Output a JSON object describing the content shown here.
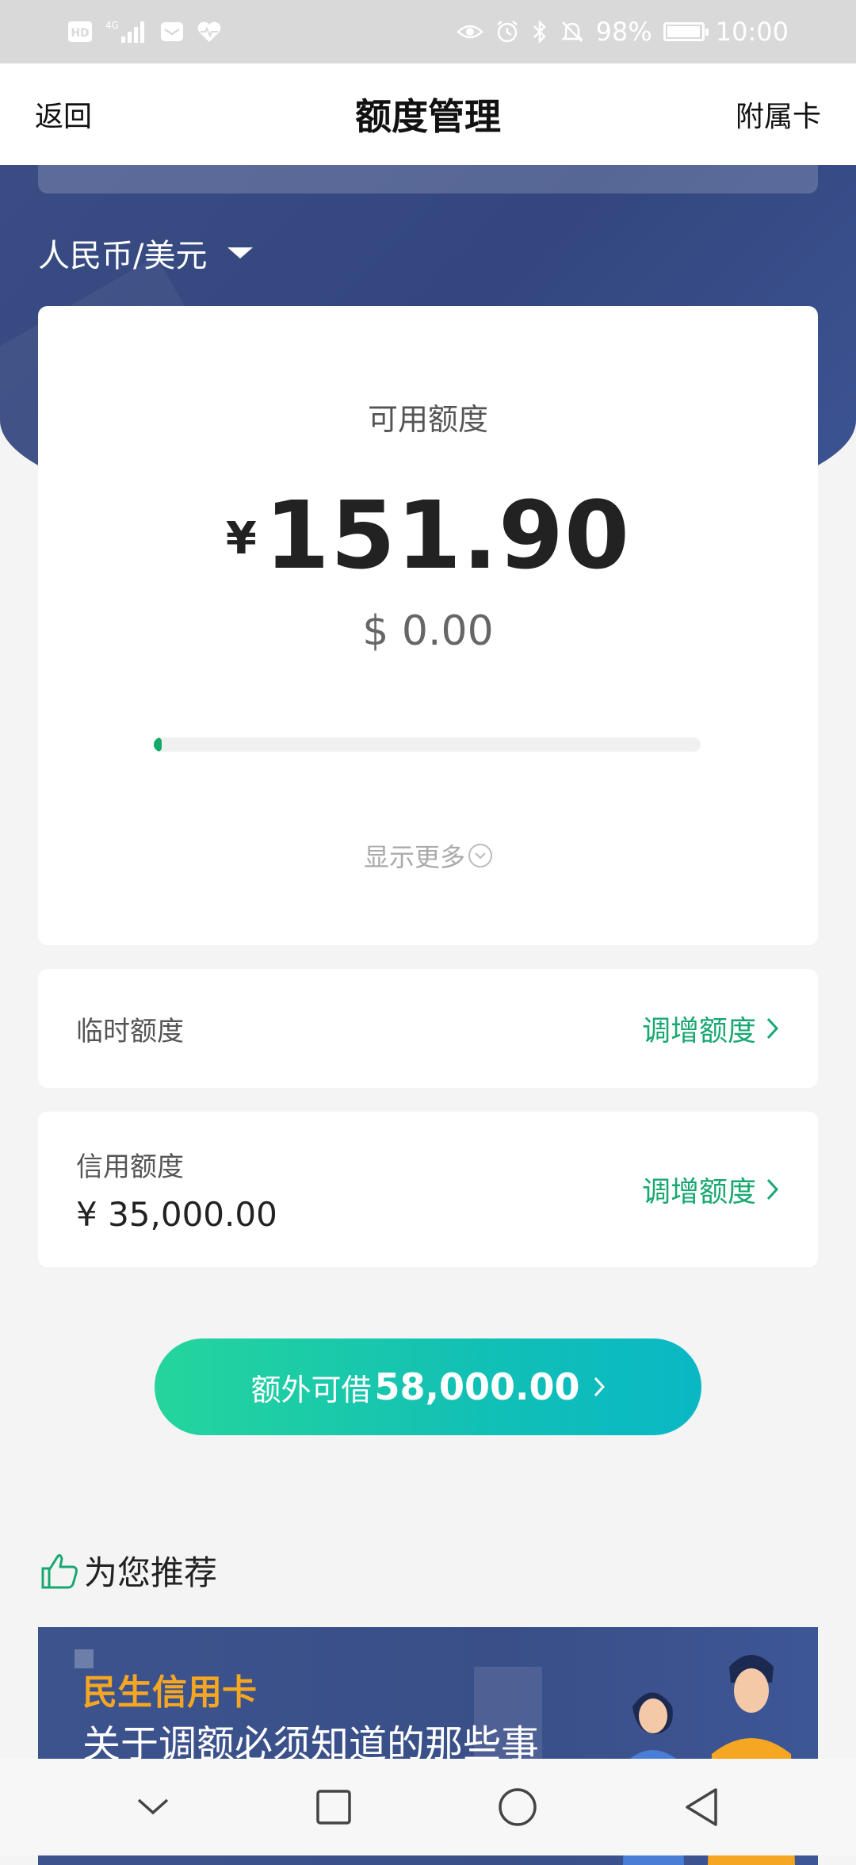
{
  "status_bar": {
    "left_icons": [
      "hd-icon",
      "signal-4g-icon",
      "message-icon",
      "health-icon"
    ],
    "hd_label": "HD",
    "network_label": "4G",
    "right_icons": [
      "eye-icon",
      "alarm-icon",
      "bluetooth-icon",
      "mute-icon"
    ],
    "battery": "98%",
    "battery_level": 0.98,
    "time": "10:00"
  },
  "navbar": {
    "back_label": "返回",
    "title": "额度管理",
    "sub_card_label": "附属卡"
  },
  "currency": {
    "selected": "人民币/美元"
  },
  "available": {
    "label": "可用额度",
    "rmb_symbol": "¥",
    "rmb_amount": "151.90",
    "usd": "$ 0.00",
    "progress_fraction": 0.01,
    "show_more": "显示更多"
  },
  "temp_limit": {
    "label": "临时额度",
    "action": "调增额度"
  },
  "credit_limit": {
    "label": "信用额度",
    "value": "¥ 35,000.00",
    "action": "调增额度"
  },
  "extra_borrow": {
    "prefix": "额外可借",
    "amount": "58,000.00"
  },
  "recommend": {
    "title": "为您推荐",
    "banner_brand": "民生信用卡",
    "banner_subtitle": "关于调额必须知道的那些事"
  },
  "colors": {
    "accent_green": "#17a870",
    "header_blue": "#3a4c84",
    "banner_orange": "#f5a623"
  }
}
